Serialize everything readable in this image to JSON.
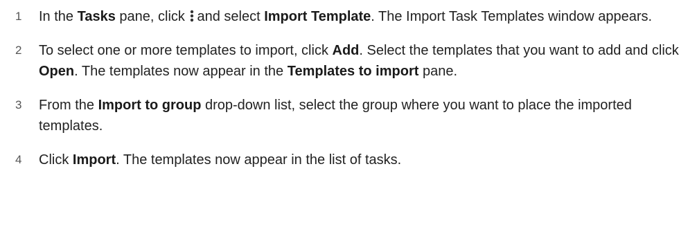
{
  "steps": [
    {
      "number": "1",
      "parts": {
        "t1": "In the ",
        "b1": "Tasks",
        "t2": " pane, click ",
        "icon": "kebab-menu-icon",
        "t3": "and select ",
        "b2": "Import Template",
        "t4": ". The Import Task Templates window appears."
      }
    },
    {
      "number": "2",
      "parts": {
        "t1": "To select one or more templates to import, click ",
        "b1": "Add",
        "t2": ". Select the templates that you want to add and click ",
        "b2": "Open",
        "t3": ". The templates now appear in the ",
        "b3": "Templates to import",
        "t4": " pane."
      }
    },
    {
      "number": "3",
      "parts": {
        "t1": "From the ",
        "b1": "Import to group",
        "t2": " drop-down list, select the group where you want to place the imported templates."
      }
    },
    {
      "number": "4",
      "parts": {
        "t1": "Click ",
        "b1": "Import",
        "t2": ". The templates now appear in the list of tasks."
      }
    }
  ],
  "colors": {
    "text": "#222222",
    "number": "#555555",
    "icon": "#333333"
  }
}
